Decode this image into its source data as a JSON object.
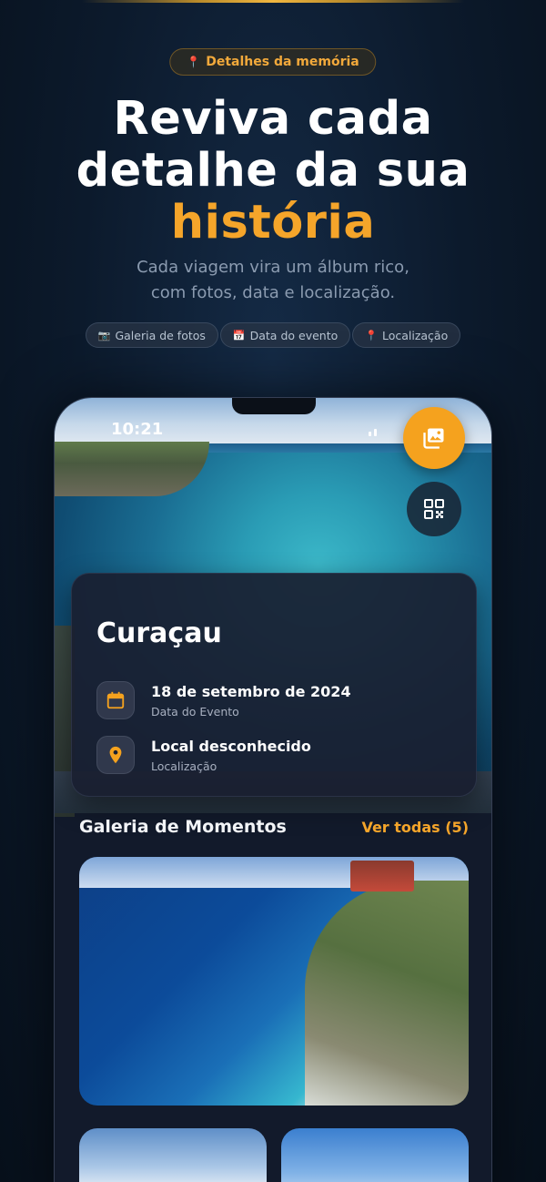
{
  "hero": {
    "badge_icon": "📍",
    "badge_label": "Detalhes da memória",
    "headline_line1": "Reviva cada",
    "headline_line2": "detalhe da sua",
    "headline_accent": "história",
    "subtitle_line1": "Cada viagem vira um álbum rico,",
    "subtitle_line2": "com fotos, data e localização."
  },
  "chips": [
    {
      "icon": "📷",
      "label": "Galeria de fotos"
    },
    {
      "icon": "📅",
      "label": "Data do evento"
    },
    {
      "icon": "📍",
      "label": "Localização"
    }
  ],
  "phone": {
    "status_time": "10:21",
    "place": "Curaçau",
    "date_value": "18 de setembro de 2024",
    "date_label": "Data do Evento",
    "location_value": "Local desconhecido",
    "location_label": "Localização",
    "gallery_title": "Galeria de Momentos",
    "gallery_view_all": "Ver todas (5)"
  },
  "colors": {
    "accent": "#f5a52a",
    "background": "#0c1a2c",
    "card": "#191e30"
  }
}
